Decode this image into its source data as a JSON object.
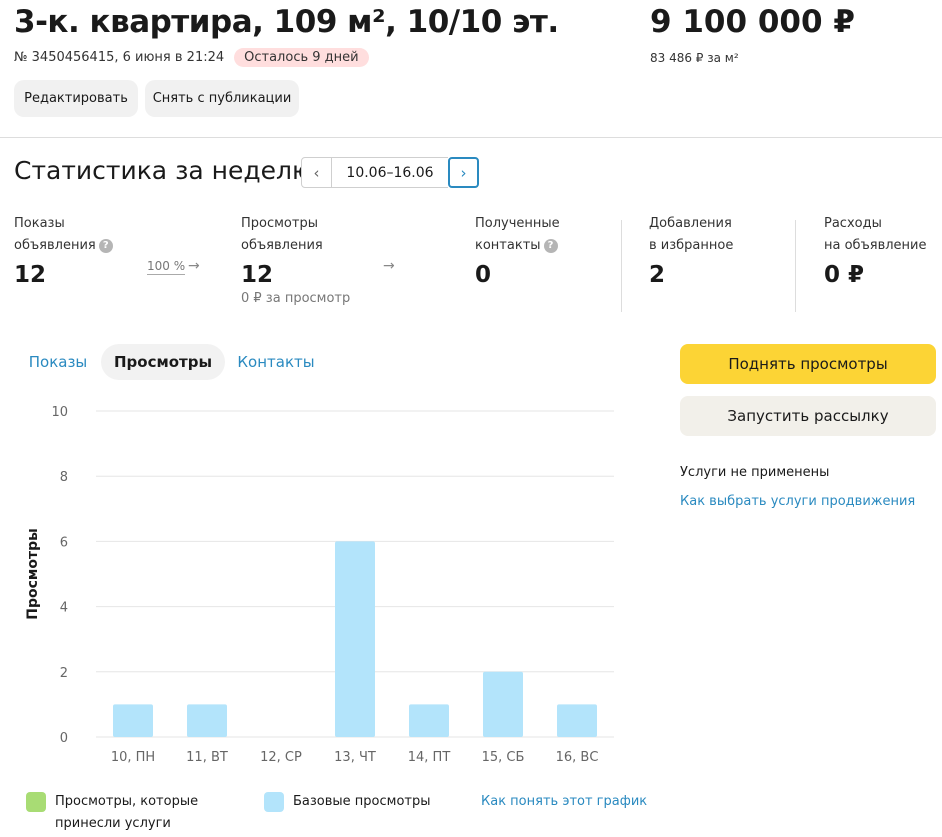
{
  "listing": {
    "title": "3-к. квартира, 109 м², 10/10 эт.",
    "id_date": "№ 3450456415, 6 июня в 21:24",
    "days_left_badge": "Осталось 9 дней",
    "price": "9 100 000 ₽",
    "price_per_m2": "83 486 ₽ за м²",
    "edit_button": "Редактировать",
    "unpublish_button": "Снять с публикации"
  },
  "stats": {
    "title": "Статистика за неделю",
    "range": "10.06–16.06",
    "metrics": {
      "impressions": {
        "label_line1": "Показы",
        "label_line2": "объявления",
        "value": "12"
      },
      "conversion": "100 %",
      "views": {
        "label_line1": "Просмотры",
        "label_line2": "объявления",
        "value": "12",
        "sub": "0 ₽ за просмотр"
      },
      "contacts": {
        "label_line1": "Полученные",
        "label_line2": "контакты",
        "value": "0"
      },
      "favorites": {
        "label_line1": "Добавления",
        "label_line2": "в избранное",
        "value": "2"
      },
      "spend": {
        "label_line1": "Расходы",
        "label_line2": "на объявление",
        "value": "0 ₽"
      }
    }
  },
  "tabs": [
    {
      "label": "Показы",
      "active": false
    },
    {
      "label": "Просмотры",
      "active": true
    },
    {
      "label": "Контакты",
      "active": false
    }
  ],
  "actions": {
    "boost_button": "Поднять просмотры",
    "mailing_button": "Запустить рассылку",
    "services_note": "Услуги не применены",
    "services_link": "Как выбрать услуги продвижения"
  },
  "colors": {
    "bar_base": "#b3e4fb",
    "bar_services": "#a8dc74",
    "accent_yellow": "#fcd435",
    "link_blue": "#2a8ac0"
  },
  "chart_data": {
    "type": "bar",
    "ylabel": "Просмотры",
    "ylim": [
      0,
      10
    ],
    "yticks": [
      0,
      2,
      4,
      6,
      8,
      10
    ],
    "grid": true,
    "categories": [
      "10, ПН",
      "11, ВТ",
      "12, СР",
      "13, ЧТ",
      "14, ПТ",
      "15, СБ",
      "16, ВС"
    ],
    "series": [
      {
        "name": "Просмотры, которые принесли услуги",
        "values": [
          0,
          0,
          0,
          0,
          0,
          0,
          0
        ],
        "color": "#a8dc74"
      },
      {
        "name": "Базовые просмотры",
        "values": [
          1,
          1,
          0,
          6,
          1,
          2,
          1
        ],
        "color": "#b3e4fb"
      }
    ]
  },
  "legend": {
    "services_line1": "Просмотры, которые",
    "services_line2": "принесли услуги",
    "base": "Базовые просмотры",
    "help_link": "Как понять этот график"
  }
}
